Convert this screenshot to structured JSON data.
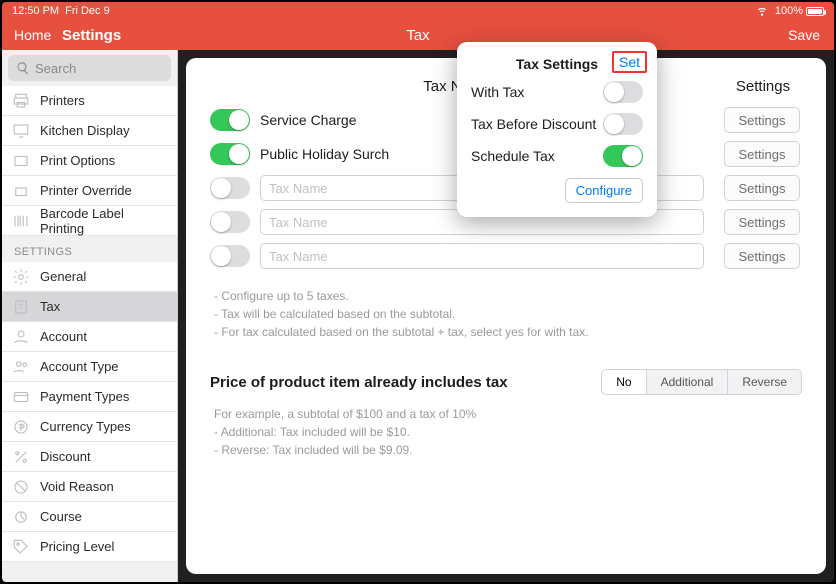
{
  "status": {
    "time": "12:50 PM",
    "date": "Fri Dec 9",
    "battery": "100%"
  },
  "nav": {
    "home": "Home",
    "settings": "Settings",
    "title": "Tax",
    "save": "Save"
  },
  "search": {
    "placeholder": "Search"
  },
  "sidebar": {
    "top": [
      {
        "label": "Printers"
      },
      {
        "label": "Kitchen Display"
      },
      {
        "label": "Print Options"
      },
      {
        "label": "Printer Override"
      },
      {
        "label": "Barcode Label Printing"
      }
    ],
    "group": "SETTINGS",
    "bottom": [
      {
        "label": "General"
      },
      {
        "label": "Tax"
      },
      {
        "label": "Account"
      },
      {
        "label": "Account Type"
      },
      {
        "label": "Payment Types"
      },
      {
        "label": "Currency Types"
      },
      {
        "label": "Discount"
      },
      {
        "label": "Void Reason"
      },
      {
        "label": "Course"
      },
      {
        "label": "Pricing Level"
      }
    ]
  },
  "taxHeader": "Tax Name",
  "settingsHeader": "Settings",
  "taxes": [
    {
      "on": true,
      "name": "Service Charge"
    },
    {
      "on": true,
      "name": "Public Holiday Surch"
    }
  ],
  "taxPlaceholder": "Tax Name",
  "settingsBtn": "Settings",
  "notes": {
    "l1": "- Configure up to 5 taxes.",
    "l2": "- Tax will be calculated based on the subtotal.",
    "l3": "- For tax calculated based on the subtotal + tax, select yes for with tax."
  },
  "priceSection": {
    "title": "Price of product item already includes tax",
    "seg": [
      "No",
      "Additional",
      "Reverse"
    ],
    "ex1": "For example, a subtotal of $100 and a tax of 10%",
    "ex2": "- Additional: Tax included will be $10.",
    "ex3": "- Reverse: Tax included will be $9.09."
  },
  "popover": {
    "title": "Tax Settings",
    "set": "Set",
    "rows": [
      {
        "label": "With Tax",
        "on": false
      },
      {
        "label": "Tax Before Discount",
        "on": false
      },
      {
        "label": "Schedule Tax",
        "on": true
      }
    ],
    "configure": "Configure"
  }
}
